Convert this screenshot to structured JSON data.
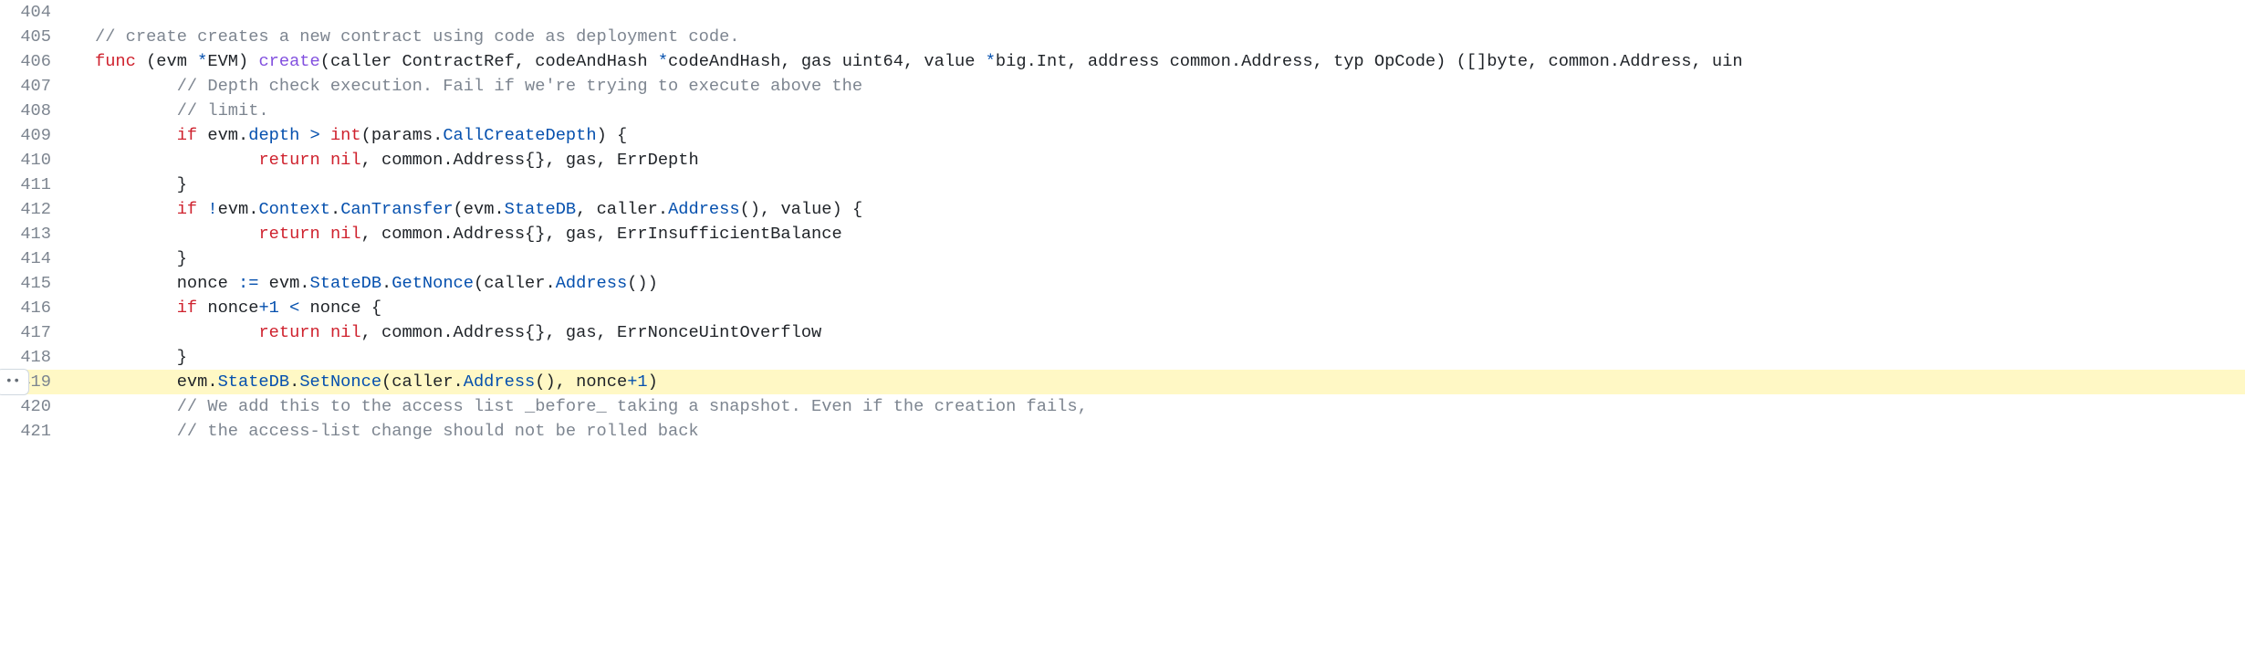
{
  "lines": [
    {
      "num": 404,
      "highlighted": false,
      "marker": false,
      "tokens": []
    },
    {
      "num": 405,
      "highlighted": false,
      "marker": false,
      "tokens": [
        {
          "cls": "comment",
          "text": "// create creates a new contract using code as deployment code."
        }
      ]
    },
    {
      "num": 406,
      "highlighted": false,
      "marker": false,
      "tokens": [
        {
          "cls": "keyword",
          "text": "func"
        },
        {
          "cls": "ident",
          "text": " (evm "
        },
        {
          "cls": "operator",
          "text": "*"
        },
        {
          "cls": "ident",
          "text": "EVM) "
        },
        {
          "cls": "func-name",
          "text": "create"
        },
        {
          "cls": "ident",
          "text": "(caller ContractRef, codeAndHash "
        },
        {
          "cls": "operator",
          "text": "*"
        },
        {
          "cls": "ident",
          "text": "codeAndHash, gas uint64, value "
        },
        {
          "cls": "operator",
          "text": "*"
        },
        {
          "cls": "ident",
          "text": "big.Int, address common.Address, typ OpCode) ([]byte, common.Address, uin"
        }
      ]
    },
    {
      "num": 407,
      "highlighted": false,
      "marker": false,
      "tokens": [
        {
          "cls": "ident",
          "text": "        "
        },
        {
          "cls": "comment",
          "text": "// Depth check execution. Fail if we're trying to execute above the"
        }
      ]
    },
    {
      "num": 408,
      "highlighted": false,
      "marker": false,
      "tokens": [
        {
          "cls": "ident",
          "text": "        "
        },
        {
          "cls": "comment",
          "text": "// limit."
        }
      ]
    },
    {
      "num": 409,
      "highlighted": false,
      "marker": false,
      "tokens": [
        {
          "cls": "ident",
          "text": "        "
        },
        {
          "cls": "keyword",
          "text": "if"
        },
        {
          "cls": "ident",
          "text": " evm."
        },
        {
          "cls": "type-name",
          "text": "depth"
        },
        {
          "cls": "ident",
          "text": " "
        },
        {
          "cls": "operator",
          "text": ">"
        },
        {
          "cls": "ident",
          "text": " "
        },
        {
          "cls": "keyword",
          "text": "int"
        },
        {
          "cls": "ident",
          "text": "(params."
        },
        {
          "cls": "type-name",
          "text": "CallCreateDepth"
        },
        {
          "cls": "ident",
          "text": ") {"
        }
      ]
    },
    {
      "num": 410,
      "highlighted": false,
      "marker": false,
      "tokens": [
        {
          "cls": "ident",
          "text": "                "
        },
        {
          "cls": "keyword",
          "text": "return"
        },
        {
          "cls": "ident",
          "text": " "
        },
        {
          "cls": "keyword",
          "text": "nil"
        },
        {
          "cls": "ident",
          "text": ", common.Address{}, gas, ErrDepth"
        }
      ]
    },
    {
      "num": 411,
      "highlighted": false,
      "marker": false,
      "tokens": [
        {
          "cls": "ident",
          "text": "        }"
        }
      ]
    },
    {
      "num": 412,
      "highlighted": false,
      "marker": false,
      "tokens": [
        {
          "cls": "ident",
          "text": "        "
        },
        {
          "cls": "keyword",
          "text": "if"
        },
        {
          "cls": "ident",
          "text": " "
        },
        {
          "cls": "operator",
          "text": "!"
        },
        {
          "cls": "ident",
          "text": "evm."
        },
        {
          "cls": "type-name",
          "text": "Context"
        },
        {
          "cls": "ident",
          "text": "."
        },
        {
          "cls": "type-name",
          "text": "CanTransfer"
        },
        {
          "cls": "ident",
          "text": "(evm."
        },
        {
          "cls": "type-name",
          "text": "StateDB"
        },
        {
          "cls": "ident",
          "text": ", caller."
        },
        {
          "cls": "type-name",
          "text": "Address"
        },
        {
          "cls": "ident",
          "text": "(), value) {"
        }
      ]
    },
    {
      "num": 413,
      "highlighted": false,
      "marker": false,
      "tokens": [
        {
          "cls": "ident",
          "text": "                "
        },
        {
          "cls": "keyword",
          "text": "return"
        },
        {
          "cls": "ident",
          "text": " "
        },
        {
          "cls": "keyword",
          "text": "nil"
        },
        {
          "cls": "ident",
          "text": ", common.Address{}, gas, ErrInsufficientBalance"
        }
      ]
    },
    {
      "num": 414,
      "highlighted": false,
      "marker": false,
      "tokens": [
        {
          "cls": "ident",
          "text": "        }"
        }
      ]
    },
    {
      "num": 415,
      "highlighted": false,
      "marker": false,
      "tokens": [
        {
          "cls": "ident",
          "text": "        nonce "
        },
        {
          "cls": "operator",
          "text": ":="
        },
        {
          "cls": "ident",
          "text": " evm."
        },
        {
          "cls": "type-name",
          "text": "StateDB"
        },
        {
          "cls": "ident",
          "text": "."
        },
        {
          "cls": "type-name",
          "text": "GetNonce"
        },
        {
          "cls": "ident",
          "text": "(caller."
        },
        {
          "cls": "type-name",
          "text": "Address"
        },
        {
          "cls": "ident",
          "text": "())"
        }
      ]
    },
    {
      "num": 416,
      "highlighted": false,
      "marker": false,
      "tokens": [
        {
          "cls": "ident",
          "text": "        "
        },
        {
          "cls": "keyword",
          "text": "if"
        },
        {
          "cls": "ident",
          "text": " nonce"
        },
        {
          "cls": "operator",
          "text": "+"
        },
        {
          "cls": "number",
          "text": "1"
        },
        {
          "cls": "ident",
          "text": " "
        },
        {
          "cls": "operator",
          "text": "<"
        },
        {
          "cls": "ident",
          "text": " nonce {"
        }
      ]
    },
    {
      "num": 417,
      "highlighted": false,
      "marker": false,
      "tokens": [
        {
          "cls": "ident",
          "text": "                "
        },
        {
          "cls": "keyword",
          "text": "return"
        },
        {
          "cls": "ident",
          "text": " "
        },
        {
          "cls": "keyword",
          "text": "nil"
        },
        {
          "cls": "ident",
          "text": ", common.Address{}, gas, ErrNonceUintOverflow"
        }
      ]
    },
    {
      "num": 418,
      "highlighted": false,
      "marker": false,
      "tokens": [
        {
          "cls": "ident",
          "text": "        }"
        }
      ]
    },
    {
      "num": 419,
      "highlighted": true,
      "marker": true,
      "marker_text": "••",
      "tokens": [
        {
          "cls": "ident",
          "text": "        evm."
        },
        {
          "cls": "type-name",
          "text": "StateDB"
        },
        {
          "cls": "ident",
          "text": "."
        },
        {
          "cls": "type-name",
          "text": "SetNonce"
        },
        {
          "cls": "ident",
          "text": "(caller."
        },
        {
          "cls": "type-name",
          "text": "Address"
        },
        {
          "cls": "ident",
          "text": "(), nonce"
        },
        {
          "cls": "operator",
          "text": "+"
        },
        {
          "cls": "number",
          "text": "1"
        },
        {
          "cls": "ident",
          "text": ")"
        }
      ]
    },
    {
      "num": 420,
      "highlighted": false,
      "marker": false,
      "tokens": [
        {
          "cls": "ident",
          "text": "        "
        },
        {
          "cls": "comment",
          "text": "// We add this to the access list _before_ taking a snapshot. Even if the creation fails,"
        }
      ]
    },
    {
      "num": 421,
      "highlighted": false,
      "marker": false,
      "tokens": [
        {
          "cls": "ident",
          "text": "        "
        },
        {
          "cls": "comment",
          "text": "// the access-list change should not be rolled back"
        }
      ]
    }
  ]
}
